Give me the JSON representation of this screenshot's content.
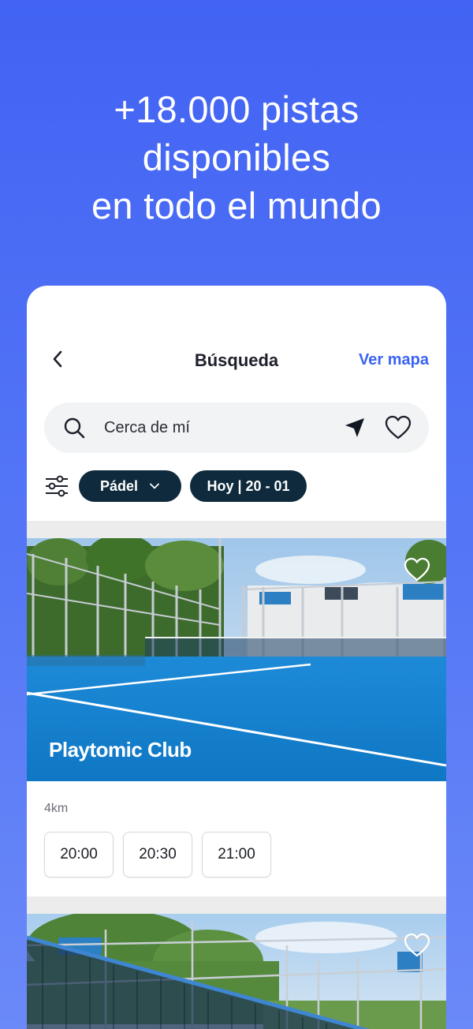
{
  "headline": {
    "line1": "+18.000 pistas",
    "line2": "disponibles",
    "line3": "en todo el mundo"
  },
  "topbar": {
    "title": "Búsqueda",
    "map_link": "Ver mapa"
  },
  "search": {
    "value": "Cerca de mí"
  },
  "filters": {
    "sport_chip": "Pádel",
    "date_chip": "Hoy | 20 - 01"
  },
  "cards": [
    {
      "club_name": "Playtomic Club",
      "distance": "4km",
      "slots": [
        "20:00",
        "20:30",
        "21:00"
      ]
    }
  ],
  "colors": {
    "background": "#4263f3",
    "accent": "#3a63f2",
    "chip": "#0e2a3c",
    "court": "#1a86d6"
  }
}
